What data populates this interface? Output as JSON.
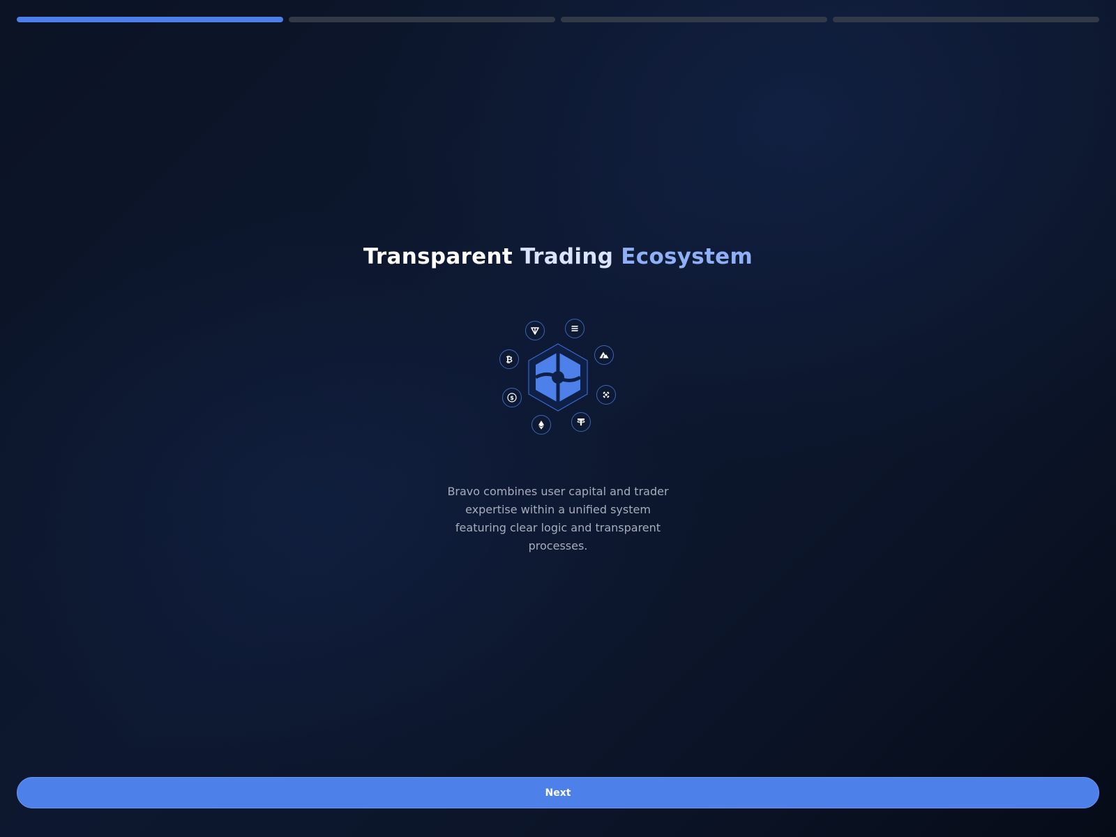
{
  "progress": {
    "total_steps": 4,
    "current_step": 1
  },
  "title": {
    "part1": "Transparent",
    "part2": "Trading",
    "part3": "Ecosystem"
  },
  "illustration": {
    "center_icon": "hexagon-logo-icon",
    "coins": [
      "ton-icon",
      "solana-icon",
      "avalanche-icon",
      "bnb-icon",
      "tether-icon",
      "ethereum-icon",
      "usdc-icon",
      "bitcoin-icon"
    ]
  },
  "description": "Bravo combines user capital and trader expertise within a unified system featuring clear logic and transparent processes.",
  "next_button": {
    "label": "Next"
  },
  "colors": {
    "accent": "#4d80e9",
    "progress_inactive": "#333a47",
    "title_highlight": "#8fb0f6",
    "text_muted": "#a6adbb"
  }
}
